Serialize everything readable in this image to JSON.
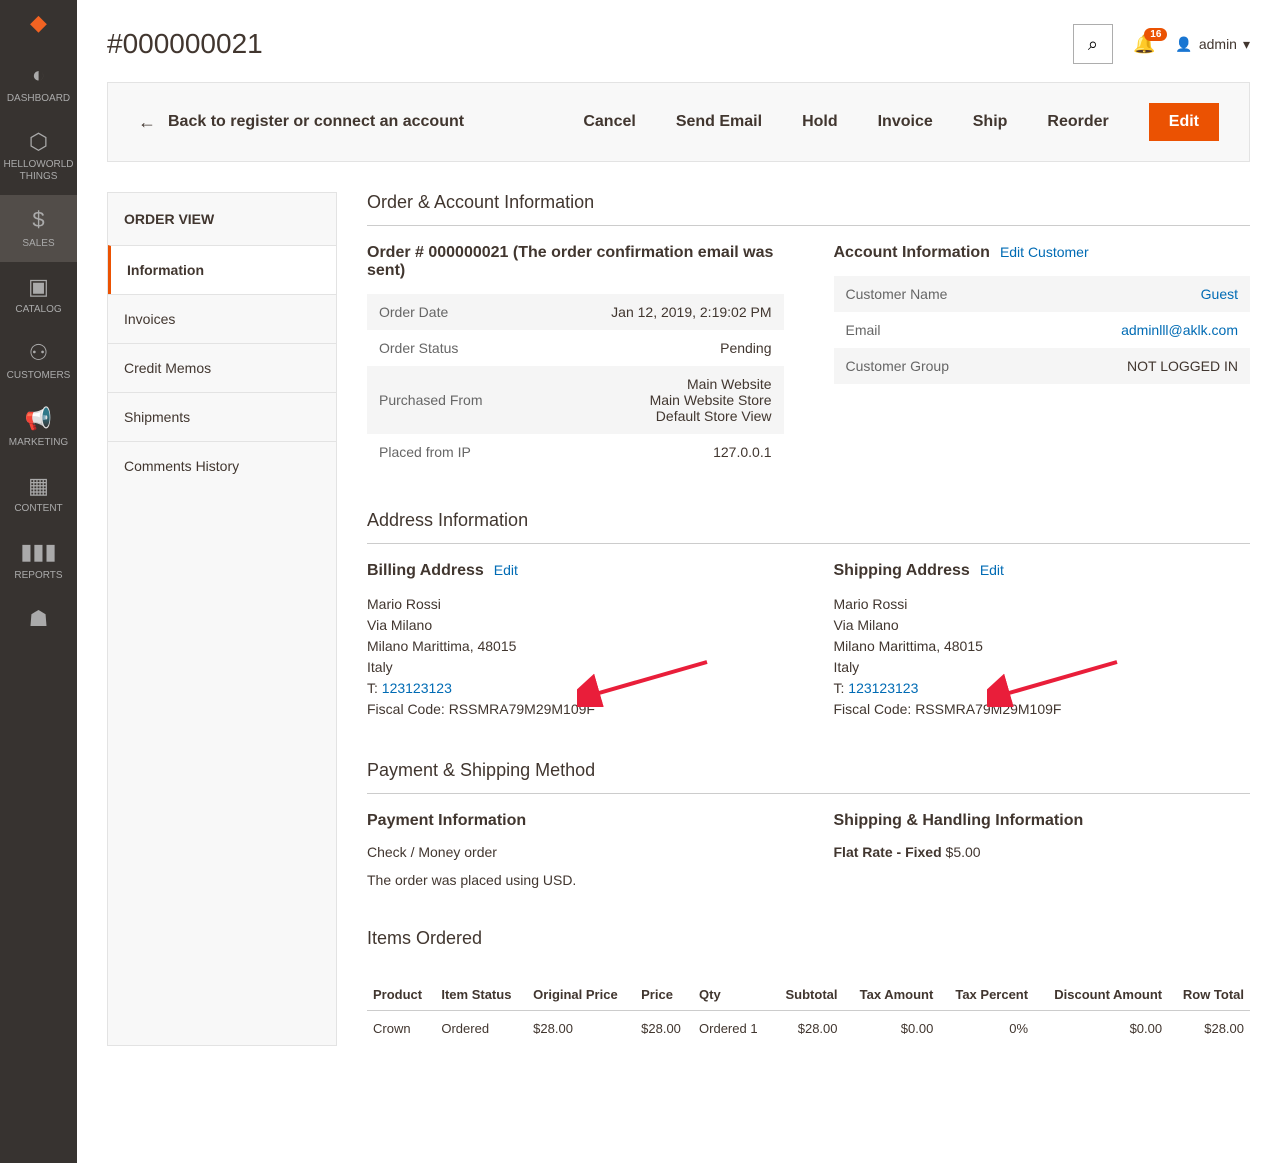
{
  "sidebar": [
    {
      "name": "dashboard",
      "label": "DASHBOARD"
    },
    {
      "name": "helloworld",
      "label": "HELLOWORLD THINGS"
    },
    {
      "name": "sales",
      "label": "SALES",
      "active": true
    },
    {
      "name": "catalog",
      "label": "CATALOG"
    },
    {
      "name": "customers",
      "label": "CUSTOMERS"
    },
    {
      "name": "marketing",
      "label": "MARKETING"
    },
    {
      "name": "content",
      "label": "CONTENT"
    },
    {
      "name": "reports",
      "label": "REPORTS"
    },
    {
      "name": "stores",
      "label": ""
    }
  ],
  "header": {
    "title": "#000000021",
    "notif_count": "16",
    "user": "admin"
  },
  "actions": {
    "back": "Back to register or connect an account",
    "cancel": "Cancel",
    "send_email": "Send Email",
    "hold": "Hold",
    "invoice": "Invoice",
    "ship": "Ship",
    "reorder": "Reorder",
    "edit": "Edit"
  },
  "order_view": {
    "title": "ORDER VIEW",
    "items": [
      {
        "label": "Information",
        "active": true
      },
      {
        "label": "Invoices"
      },
      {
        "label": "Credit Memos"
      },
      {
        "label": "Shipments"
      },
      {
        "label": "Comments History"
      }
    ]
  },
  "sections": {
    "order_account": "Order & Account Information",
    "address": "Address Information",
    "payment_shipping": "Payment & Shipping Method",
    "items": "Items Ordered"
  },
  "order_info": {
    "title": "Order # 000000021 (The order confirmation email was sent)",
    "rows": [
      {
        "label": "Order Date",
        "value": "Jan 12, 2019, 2:19:02 PM"
      },
      {
        "label": "Order Status",
        "value": "Pending"
      },
      {
        "label": "Purchased From",
        "value": "Main Website\nMain Website Store\nDefault Store View"
      },
      {
        "label": "Placed from IP",
        "value": "127.0.0.1"
      }
    ]
  },
  "account_info": {
    "title": "Account Information",
    "edit": "Edit Customer",
    "rows": [
      {
        "label": "Customer Name",
        "value": "Guest",
        "link": true
      },
      {
        "label": "Email",
        "value": "adminlll@aklk.com",
        "link": true
      },
      {
        "label": "Customer Group",
        "value": "NOT LOGGED IN"
      }
    ]
  },
  "billing": {
    "title": "Billing Address",
    "edit": "Edit",
    "name": "Mario Rossi",
    "street": "Via Milano",
    "city": "Milano Marittima, 48015",
    "country": "Italy",
    "phone_label": "T: ",
    "phone": "123123123",
    "fiscal": "Fiscal Code: RSSMRA79M29M109F"
  },
  "shipping": {
    "title": "Shipping Address",
    "edit": "Edit",
    "name": "Mario Rossi",
    "street": "Via Milano",
    "city": "Milano Marittima, 48015",
    "country": "Italy",
    "phone_label": "T: ",
    "phone": "123123123",
    "fiscal": "Fiscal Code: RSSMRA79M29M109F"
  },
  "payment": {
    "title": "Payment Information",
    "method": "Check / Money order",
    "note": "The order was placed using USD."
  },
  "shipping_method": {
    "title": "Shipping & Handling Information",
    "method": "Flat Rate - Fixed",
    "amount": "$5.00"
  },
  "items_table": {
    "headers": [
      "Product",
      "Item Status",
      "Original Price",
      "Price",
      "Qty",
      "Subtotal",
      "Tax Amount",
      "Tax Percent",
      "Discount Amount",
      "Row Total"
    ],
    "row": {
      "product": "Crown",
      "status": "Ordered",
      "orig_price": "$28.00",
      "price": "$28.00",
      "qty": "Ordered 1",
      "subtotal": "$28.00",
      "tax_amount": "$0.00",
      "tax_percent": "0%",
      "discount": "$0.00",
      "row_total": "$28.00"
    }
  }
}
